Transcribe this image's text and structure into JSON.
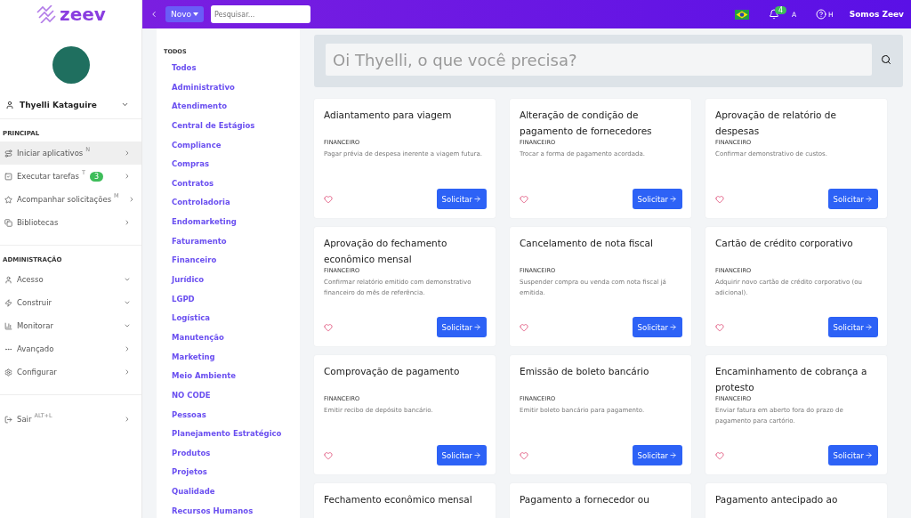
{
  "logo": {
    "text": "zeev"
  },
  "topbar": {
    "new_button": "Novo",
    "search": {
      "placeholder": "Pesquisar..."
    },
    "notifications": {
      "count": "4",
      "shortcut": "A"
    },
    "help": {
      "shortcut": "H"
    },
    "company": "Somos Zeev"
  },
  "user": {
    "name": "Thyelli Kataguire"
  },
  "sidebar": {
    "sections": [
      {
        "title": "PRINCIPAL",
        "items": [
          {
            "label": "Iniciar aplicativos",
            "shortcut": "N",
            "kind": "sub",
            "selected": true
          },
          {
            "label": "Executar tarefas",
            "shortcut": "T",
            "badge": "3",
            "kind": "sub",
            "selected": false
          },
          {
            "label": "Acompanhar solicitações",
            "shortcut": "M",
            "kind": "sub",
            "selected": false
          },
          {
            "label": "Bibliotecas",
            "kind": "sub",
            "selected": false
          }
        ]
      },
      {
        "title": "ADMINISTRAÇÃO",
        "items": [
          {
            "label": "Acesso",
            "kind": "expand",
            "selected": false
          },
          {
            "label": "Construir",
            "kind": "expand",
            "selected": false
          },
          {
            "label": "Monitorar",
            "kind": "expand",
            "selected": false
          },
          {
            "label": "Avançado",
            "kind": "sub",
            "selected": false
          },
          {
            "label": "Configurar",
            "kind": "sub",
            "selected": false
          }
        ]
      },
      {
        "items": [
          {
            "label": "Sair",
            "shortcut": "ALT+L",
            "kind": "sub",
            "selected": false
          }
        ]
      }
    ]
  },
  "categories": {
    "title": "TODOS",
    "items": [
      "Todos",
      "Administrativo",
      "Atendimento",
      "Central de Estágios",
      "Compliance",
      "Compras",
      "Contratos",
      "Controladoria",
      "Endomarketing",
      "Faturamento",
      "Financeiro",
      "Jurídico",
      "LGPD",
      "Logística",
      "Manutenção",
      "Marketing",
      "Meio Ambiente",
      "NO CODE",
      "Pessoas",
      "Planejamento Estratégico",
      "Produtos",
      "Projetos",
      "Qualidade",
      "Recursos Humanos"
    ]
  },
  "search": {
    "placeholder": "Oi Thyelli, o que você precisa?"
  },
  "cards": [
    {
      "title": "Adiantamento para viagem",
      "category": "FINANCEIRO",
      "description": "Pagar prévia de despesa inerente a viagem futura.",
      "button": "Solicitar",
      "favorite": false
    },
    {
      "title": "Alteração de condição de pagamento de fornecedores",
      "category": "FINANCEIRO",
      "description": "Trocar a forma de pagamento acordada.",
      "button": "Solicitar",
      "favorite": false
    },
    {
      "title": "Aprovação de relatório de despesas",
      "category": "FINANCEIRO",
      "description": "Confirmar demonstrativo de custos.",
      "button": "Solicitar",
      "favorite": false
    },
    {
      "title": "Aprovação do fechamento econômico mensal",
      "category": "FINANCEIRO",
      "description": "Confirmar relatório emitido com demonstrativo financeiro do mês de referência.",
      "button": "Solicitar",
      "favorite": false
    },
    {
      "title": "Cancelamento de nota fiscal",
      "category": "FINANCEIRO",
      "description": "Suspender compra ou venda com nota fiscal já emitida.",
      "button": "Solicitar",
      "favorite": false
    },
    {
      "title": "Cartão de crédito corporativo",
      "category": "FINANCEIRO",
      "description": "Adquirir novo cartão de crédito corporativo (ou adicional).",
      "button": "Solicitar",
      "favorite": false
    },
    {
      "title": "Comprovação de pagamento",
      "category": "FINANCEIRO",
      "description": "Emitir recibo de depósito bancário.",
      "button": "Solicitar",
      "favorite": false
    },
    {
      "title": "Emissão de boleto bancário",
      "category": "FINANCEIRO",
      "description": "Emitir boleto bancário para pagamento.",
      "button": "Solicitar",
      "favorite": false
    },
    {
      "title": "Encaminhamento de cobrança a protesto",
      "category": "FINANCEIRO",
      "description": "Enviar fatura em aberto fora do prazo de pagamento para cartório.",
      "button": "Solicitar",
      "favorite": false
    },
    {
      "title": "Fechamento econômico mensal"
    },
    {
      "title": "Pagamento a fornecedor ou"
    },
    {
      "title": "Pagamento antecipado ao"
    }
  ]
}
